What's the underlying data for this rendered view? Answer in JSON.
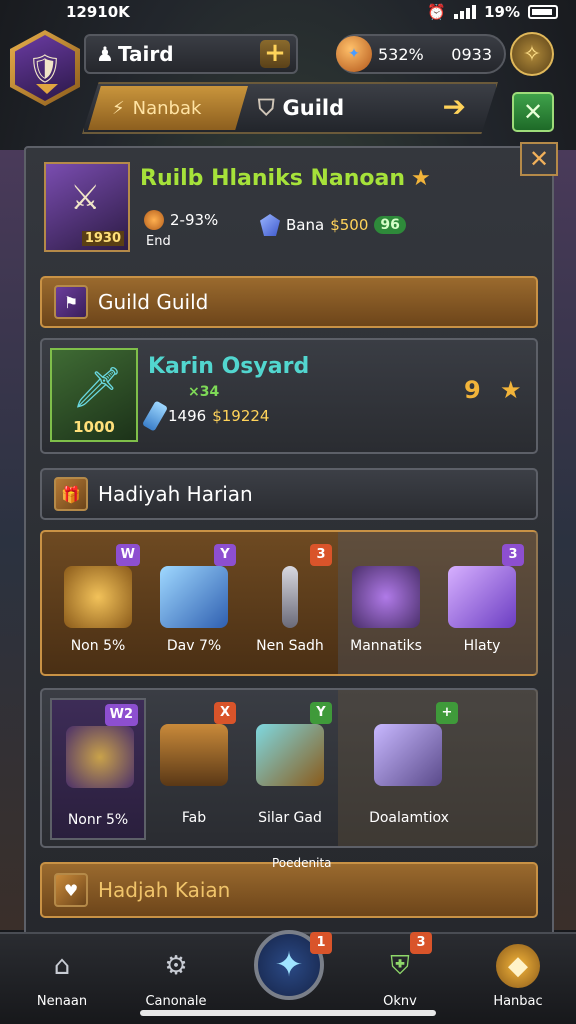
{
  "status": {
    "time": "12910K",
    "battery_pct": "19%"
  },
  "header": {
    "player_name": "Taird",
    "currency_a": "532%",
    "currency_b": "0933",
    "name_plus": "+"
  },
  "tabs": {
    "active": "Nanbak",
    "other": "Guild"
  },
  "profile": {
    "title": "Ruilb Hlaniks Nanoan",
    "level_badge": "1930",
    "stat1_value": "2-93%",
    "stat1_sub": "End",
    "stat2_label": "Bana",
    "stat2_gold": "$500",
    "stat2_pill": "96"
  },
  "sections": {
    "guild_header": "Guild Guild",
    "daily_header": "Hadiyah Harian",
    "bottom_header": "Hadjah Kaian",
    "bottom_header_sub": "Poedenita"
  },
  "guild_card": {
    "name": "Karin Osyard",
    "sub": "×34",
    "level": "1000",
    "stat_a": "1496",
    "stat_b": "$19224",
    "count": "9"
  },
  "rewards_row1": [
    {
      "label": "Non 5%",
      "badge": "W",
      "badge_color": "purple"
    },
    {
      "label": "Dav 7%",
      "badge": "Y",
      "badge_color": "purple"
    },
    {
      "label": "Nen Sadh",
      "badge": "3",
      "badge_color": "red"
    },
    {
      "label": "Mannatiks",
      "badge": "",
      "badge_color": ""
    },
    {
      "label": "Hlaty",
      "badge": "3",
      "badge_color": "purple"
    }
  ],
  "rewards_row2": [
    {
      "label": "Nonr 5%",
      "badge": "W2",
      "badge_color": "purple"
    },
    {
      "label": "Fab",
      "badge": "X",
      "badge_color": "red"
    },
    {
      "label": "Silar Gad",
      "badge": "Y",
      "badge_color": "green"
    },
    {
      "label": "Doalamtiox",
      "badge": "+",
      "badge_color": "green"
    }
  ],
  "nav": [
    {
      "label": "Nenaan"
    },
    {
      "label": "Canonale"
    },
    {
      "label": "",
      "badge": "1"
    },
    {
      "label": "Oknv",
      "badge": "3"
    },
    {
      "label": "Hanbac"
    }
  ]
}
